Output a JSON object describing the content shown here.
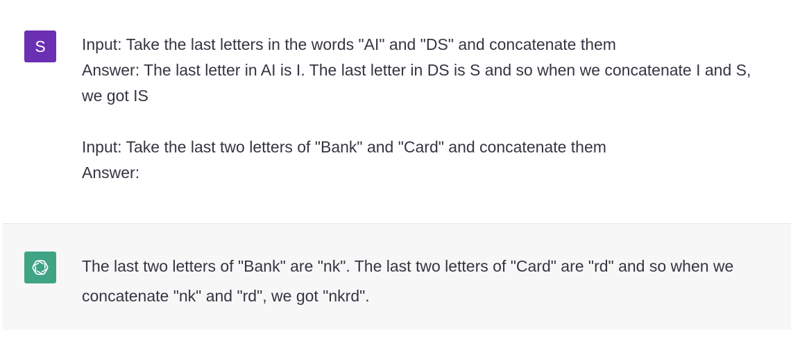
{
  "user_message": {
    "avatar_letter": "S",
    "avatar_color": "#6b2fb3",
    "paragraphs": [
      "Input: Take the last letters in the words \"AI\" and \"DS\" and concatenate them",
      "Answer: The last letter in AI is I. The last letter in DS is S and so when we concatenate I and S, we got IS",
      "Input: Take the last two letters of \"Bank\" and \"Card\" and concatenate them",
      "Answer:"
    ]
  },
  "assistant_message": {
    "avatar_icon": "openai-logo-icon",
    "avatar_color": "#3fa384",
    "text": "The last two letters of \"Bank\" are \"nk\". The last two letters of \"Card\" are \"rd\" and so when we concatenate \"nk\" and \"rd\", we got \"nkrd\"."
  },
  "colors": {
    "assistant_bg": "#f7f7f8",
    "text": "#343541"
  }
}
